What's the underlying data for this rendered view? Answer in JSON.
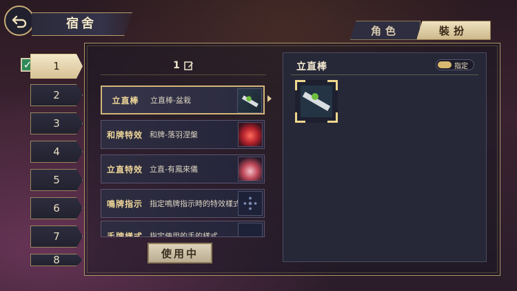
{
  "header": {
    "title": "宿舍"
  },
  "tabs": [
    {
      "label": "角色",
      "active": false
    },
    {
      "label": "裝扮",
      "active": true
    }
  ],
  "slots": [
    "1",
    "2",
    "3",
    "4",
    "5",
    "6",
    "7",
    "8"
  ],
  "active_slot": "1",
  "middle": {
    "preset_label": "1",
    "items": [
      {
        "category": "立直棒",
        "name": "立直棒-盆栽",
        "icon": "riichi-stick-bonsai-icon",
        "selected": true
      },
      {
        "category": "和牌特效",
        "name": "和牌-落羽涅槃",
        "icon": "win-effect-phoenix-icon",
        "selected": false
      },
      {
        "category": "立直特效",
        "name": "立直-有鳳來儀",
        "icon": "riichi-effect-phoenix-icon",
        "selected": false
      },
      {
        "category": "鳴牌指示",
        "name": "指定鳴牌指示時的特效樣式",
        "icon": "call-indicator-icon",
        "selected": false
      },
      {
        "category": "手牌樣式",
        "name": "指定使用的手的樣式",
        "icon": "hand-style-icon",
        "selected": false
      }
    ],
    "in_use_button": "使用中"
  },
  "right": {
    "title": "立直棒",
    "assign_label": "指定",
    "preview_icon": "riichi-stick-bonsai-icon"
  },
  "colors": {
    "accent_gold": "#d4b878",
    "panel": "#262838",
    "tab_active": "#e8d9b4"
  }
}
